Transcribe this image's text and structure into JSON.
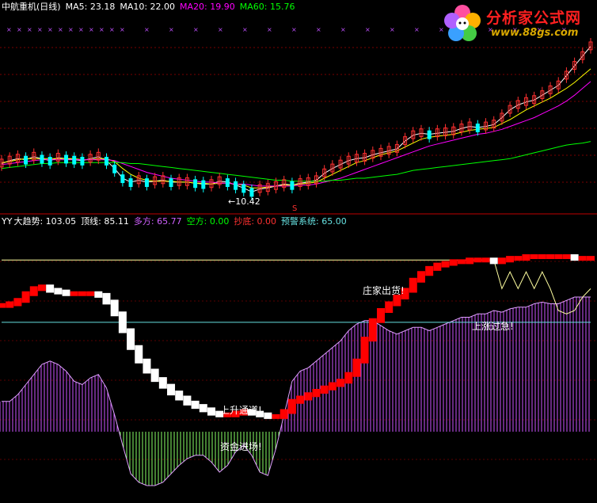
{
  "top_panel": {
    "title": "中航重机(日线)",
    "ma5_label": "MA5:",
    "ma5": "23.18",
    "ma10_label": "MA10:",
    "ma10": "22.00",
    "ma20_label": "MA20:",
    "ma20": "19.90",
    "ma60_label": "MA60:",
    "ma60": "15.76",
    "low_marker": "←10.42",
    "s_marker": "S"
  },
  "bottom_panel": {
    "prefix": "YY",
    "trend_label": "大趋势:",
    "trend": "103.05",
    "top_label": "顶线:",
    "top": "85.11",
    "bull_label": "多方:",
    "bull": "65.77",
    "bear_label": "空方:",
    "bear": "0.00",
    "bottom_label": "抄底:",
    "bottom": "0.00",
    "warn_label": "预警系统:",
    "warn": "65.00"
  },
  "annotations": {
    "up_channel": "上升通道!",
    "fund_entry": "资金进场!",
    "dealer_selling": "庄家出货!",
    "overheat": "上涨过急!"
  },
  "logo": {
    "title": "分析家公式网",
    "url": "www.88gs.com"
  },
  "colors": {
    "ma5": "#ffffff",
    "ma10": "#ffff00",
    "ma20": "#ff00ff",
    "ma60": "#00ff00",
    "up_candle": "#ff3030",
    "down_candle": "#00ffff",
    "trend_up": "#ff0000",
    "trend_down": "#ffffff",
    "top_line": "#ffffa0",
    "bull_bars": "#cc55ff",
    "bear_bars": "#88ff66",
    "warn_line": "#66e0e0",
    "divider": "#c00000"
  },
  "chart_data": [
    {
      "type": "line",
      "title": "中航重机(日线)",
      "note": "K-line price chart with moving averages (approximate, read from shape)",
      "x": [
        0,
        10,
        20,
        30,
        40,
        50,
        60,
        70,
        80,
        90,
        100,
        110,
        120,
        130,
        140,
        150,
        160,
        170,
        180,
        190,
        200,
        210,
        220,
        230,
        240,
        250,
        260,
        270,
        280,
        290,
        300,
        310,
        320,
        330,
        340,
        350,
        360,
        370,
        380,
        390,
        400,
        410,
        420,
        430,
        440,
        450,
        460,
        470,
        480,
        490,
        500,
        510,
        520,
        530,
        540,
        550,
        560,
        570,
        580,
        590,
        600,
        610,
        620,
        630,
        640,
        650,
        660,
        670,
        680,
        690,
        700,
        710,
        720,
        730
      ],
      "series": [
        {
          "name": "MA5",
          "values": [
            13.5,
            13.8,
            14.0,
            13.9,
            14.2,
            14.0,
            13.8,
            14.1,
            14.0,
            13.9,
            13.8,
            14.0,
            14.2,
            13.8,
            13.0,
            12.0,
            11.6,
            11.8,
            11.6,
            11.7,
            11.8,
            11.6,
            11.6,
            11.6,
            11.5,
            11.4,
            11.4,
            11.7,
            11.6,
            11.3,
            11.0,
            10.6,
            10.9,
            11.0,
            11.2,
            11.4,
            11.3,
            11.5,
            11.6,
            11.8,
            12.5,
            13.0,
            13.4,
            13.8,
            14.0,
            14.1,
            14.4,
            14.6,
            14.8,
            15.0,
            15.8,
            16.4,
            16.6,
            16.5,
            16.6,
            16.7,
            16.8,
            17.1,
            17.3,
            17.2,
            17.3,
            17.5,
            18.2,
            19.0,
            19.5,
            19.8,
            20.0,
            20.5,
            21.0,
            21.5,
            22.5,
            23.5,
            24.5,
            25.5
          ]
        },
        {
          "name": "MA10",
          "values": [
            13.6,
            13.7,
            13.9,
            14.0,
            14.0,
            14.0,
            14.0,
            14.0,
            14.0,
            14.0,
            13.9,
            13.9,
            14.0,
            14.0,
            13.7,
            13.0,
            12.4,
            12.0,
            11.8,
            11.7,
            11.7,
            11.7,
            11.6,
            11.6,
            11.5,
            11.5,
            11.4,
            11.5,
            11.5,
            11.4,
            11.3,
            11.0,
            11.0,
            11.1,
            11.2,
            11.3,
            11.3,
            11.4,
            11.5,
            11.6,
            12.0,
            12.4,
            12.8,
            13.2,
            13.6,
            13.8,
            14.1,
            14.4,
            14.6,
            14.8,
            15.2,
            15.6,
            16.0,
            16.2,
            16.3,
            16.4,
            16.5,
            16.7,
            16.9,
            17.0,
            17.1,
            17.2,
            17.6,
            18.0,
            18.5,
            19.0,
            19.4,
            19.8,
            20.2,
            20.7,
            21.2,
            21.8,
            22.5,
            23.2
          ]
        },
        {
          "name": "MA20",
          "values": [
            13.4,
            13.5,
            13.6,
            13.7,
            13.8,
            13.9,
            13.9,
            13.9,
            13.9,
            13.9,
            13.9,
            13.9,
            13.9,
            13.9,
            13.8,
            13.5,
            13.2,
            12.9,
            12.6,
            12.4,
            12.2,
            12.0,
            11.9,
            11.8,
            11.7,
            11.6,
            11.6,
            11.5,
            11.5,
            11.4,
            11.4,
            11.3,
            11.2,
            11.2,
            11.2,
            11.2,
            11.2,
            11.3,
            11.3,
            11.4,
            11.6,
            11.8,
            12.0,
            12.3,
            12.6,
            12.9,
            13.2,
            13.5,
            13.8,
            14.1,
            14.4,
            14.7,
            15.0,
            15.3,
            15.5,
            15.7,
            15.9,
            16.1,
            16.3,
            16.5,
            16.6,
            16.8,
            17.0,
            17.3,
            17.6,
            17.9,
            18.2,
            18.6,
            19.0,
            19.4,
            19.9,
            20.5,
            21.2,
            21.9
          ]
        },
        {
          "name": "MA60",
          "values": [
            13.0,
            13.1,
            13.2,
            13.3,
            13.4,
            13.5,
            13.5,
            13.6,
            13.6,
            13.6,
            13.6,
            13.6,
            13.6,
            13.6,
            13.6,
            13.6,
            13.5,
            13.5,
            13.4,
            13.3,
            13.2,
            13.1,
            13.0,
            12.9,
            12.8,
            12.7,
            12.6,
            12.5,
            12.4,
            12.3,
            12.2,
            12.1,
            12.0,
            11.9,
            11.8,
            11.8,
            11.7,
            11.7,
            11.7,
            11.7,
            11.7,
            11.8,
            11.8,
            11.9,
            12.0,
            12.0,
            12.1,
            12.2,
            12.3,
            12.4,
            12.6,
            12.8,
            12.9,
            13.0,
            13.1,
            13.2,
            13.3,
            13.4,
            13.5,
            13.6,
            13.7,
            13.8,
            13.9,
            14.0,
            14.2,
            14.4,
            14.6,
            14.8,
            15.0,
            15.2,
            15.4,
            15.5,
            15.6,
            15.76
          ]
        }
      ]
    },
    {
      "type": "line",
      "note": "YY indicator panel (approximate values, 0-120 scale)",
      "x": [
        0,
        10,
        20,
        30,
        40,
        50,
        60,
        70,
        80,
        90,
        100,
        110,
        120,
        130,
        140,
        150,
        160,
        170,
        180,
        190,
        200,
        210,
        220,
        230,
        240,
        250,
        260,
        270,
        280,
        290,
        300,
        310,
        320,
        330,
        340,
        350,
        360,
        370,
        380,
        390,
        400,
        410,
        420,
        430,
        440,
        450,
        460,
        470,
        480,
        490,
        500,
        510,
        520,
        530,
        540,
        550,
        560,
        570,
        580,
        590,
        600,
        610,
        620,
        630,
        640,
        650,
        660,
        670,
        680,
        690,
        700,
        710,
        720,
        730
      ],
      "series": [
        {
          "name": "大趋势",
          "values": [
            75,
            76,
            78,
            82,
            85,
            86,
            84,
            83,
            82,
            82,
            82,
            82,
            81,
            77,
            70,
            60,
            50,
            42,
            36,
            31,
            27,
            23,
            20,
            17,
            15,
            13,
            11,
            10,
            10,
            11,
            12,
            11,
            10,
            9,
            9,
            12,
            18,
            20,
            22,
            24,
            26,
            28,
            30,
            34,
            42,
            55,
            66,
            72,
            76,
            80,
            84,
            90,
            94,
            97,
            99,
            100,
            101,
            101,
            102,
            102,
            102,
            101,
            102,
            103,
            103,
            104,
            104,
            104,
            104,
            104,
            104,
            103,
            103,
            103
          ]
        },
        {
          "name": "顶线",
          "values": [
            102,
            102,
            102,
            102,
            102,
            102,
            102,
            102,
            102,
            102,
            102,
            102,
            102,
            102,
            102,
            102,
            102,
            102,
            102,
            102,
            102,
            102,
            102,
            102,
            102,
            102,
            102,
            102,
            102,
            102,
            102,
            102,
            102,
            102,
            102,
            102,
            102,
            102,
            102,
            102,
            102,
            102,
            102,
            102,
            102,
            102,
            102,
            102,
            102,
            102,
            102,
            102,
            102,
            102,
            102,
            102,
            102,
            102,
            102,
            102,
            102,
            102,
            85,
            95,
            85,
            95,
            85,
            95,
            85,
            72,
            70,
            72,
            80,
            85
          ]
        },
        {
          "name": "多方",
          "values": [
            18,
            18,
            22,
            28,
            34,
            40,
            42,
            40,
            36,
            30,
            28,
            32,
            34,
            26,
            10,
            -8,
            -25,
            -30,
            -32,
            -32,
            -30,
            -25,
            -20,
            -16,
            -14,
            -14,
            -18,
            -24,
            -20,
            -12,
            -8,
            -14,
            -24,
            -26,
            -10,
            10,
            30,
            36,
            38,
            42,
            46,
            50,
            54,
            60,
            64,
            66,
            66,
            63,
            60,
            58,
            60,
            62,
            62,
            60,
            62,
            64,
            66,
            68,
            68,
            70,
            70,
            72,
            71,
            73,
            74,
            74,
            76,
            77,
            76,
            76,
            78,
            80,
            80,
            80
          ]
        },
        {
          "name": "预警系统",
          "values": [
            65,
            65,
            65,
            65,
            65,
            65,
            65,
            65,
            65,
            65,
            65,
            65,
            65,
            65,
            65,
            65,
            65,
            65,
            65,
            65,
            65,
            65,
            65,
            65,
            65,
            65,
            65,
            65,
            65,
            65,
            65,
            65,
            65,
            65,
            65,
            65,
            65,
            65,
            65,
            65,
            65,
            65,
            65,
            65,
            65,
            65,
            65,
            65,
            65,
            65,
            65,
            65,
            65,
            65,
            65,
            65,
            65,
            65,
            65,
            65,
            65,
            65,
            65,
            65,
            65,
            65,
            65,
            65,
            65,
            65,
            65,
            65,
            65,
            65
          ]
        }
      ]
    }
  ]
}
